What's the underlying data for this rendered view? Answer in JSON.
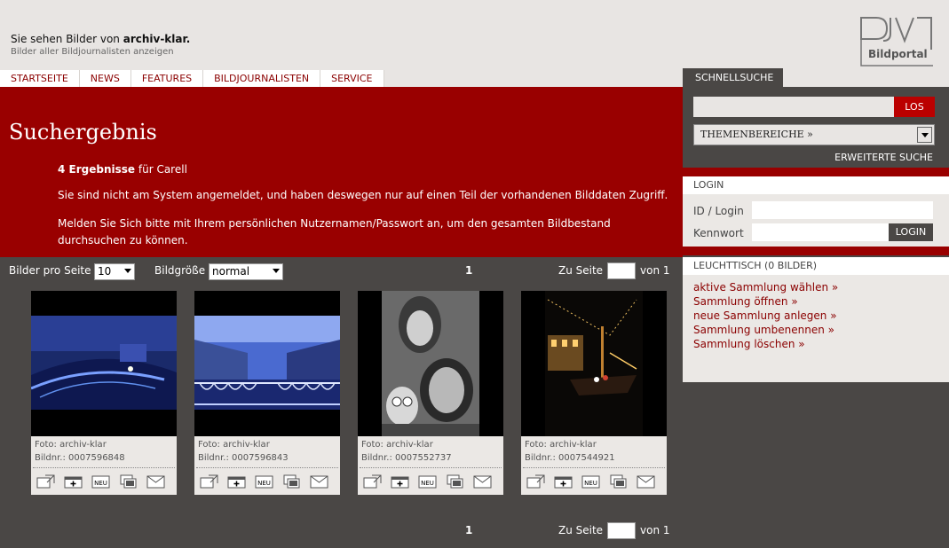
{
  "header": {
    "viewing_prefix": "Sie sehen Bilder von",
    "viewing_name": "archiv-klar.",
    "view_all_link": "Bilder aller Bildjournalisten anzeigen",
    "logo_text": "Bildportal"
  },
  "nav": {
    "items": [
      "STARTSEITE",
      "NEWS",
      "FEATURES",
      "BILDJOURNALISTEN",
      "SERVICE"
    ]
  },
  "banner": {
    "title": "Suchergebnis",
    "result_count": "4 Ergebnisse",
    "result_for": "für Carell",
    "notice1": "Sie sind nicht am System angemeldet, und haben deswegen nur auf einen Teil der vorhandenen Bilddaten Zugriff.",
    "notice2": "Melden Sie Sich bitte mit Ihrem persönlichen Nutzernamen/Passwort an, um den gesamten Bildbestand durchsuchen zu können."
  },
  "controls": {
    "per_page_label": "Bilder pro Seite",
    "per_page_value": "10",
    "size_label": "Bildgröße",
    "size_value": "normal",
    "page_current": "1",
    "goto_label": "Zu Seite",
    "of_label": "von 1"
  },
  "results": [
    {
      "foto": "Foto: archiv-klar",
      "bildnr": "Bildnr.: 0007596848"
    },
    {
      "foto": "Foto: archiv-klar",
      "bildnr": "Bildnr.: 0007596843"
    },
    {
      "foto": "Foto: archiv-klar",
      "bildnr": "Bildnr.: 0007552737"
    },
    {
      "foto": "Foto: archiv-klar",
      "bildnr": "Bildnr.: 0007544921"
    }
  ],
  "sidebar": {
    "quick_search_tab": "SCHNELLSUCHE",
    "search_button": "LOS",
    "topics_select": "THEMENBEREICHE »",
    "advanced_search": "ERWEITERTE SUCHE",
    "login_header": "LOGIN",
    "id_label": "ID / Login",
    "password_label": "Kennwort",
    "login_button": "LOGIN",
    "lighttable_header": "LEUCHTTISCH (0 BILDER)",
    "lighttable_links": [
      "aktive Sammlung wählen »",
      "Sammlung öffnen »",
      "neue Sammlung anlegen »",
      "Sammlung umbenennen »",
      "Sammlung löschen »"
    ]
  },
  "colors": {
    "brand_red": "#990000",
    "dark_bg": "#4a4745",
    "light_bg": "#e8e5e3"
  }
}
